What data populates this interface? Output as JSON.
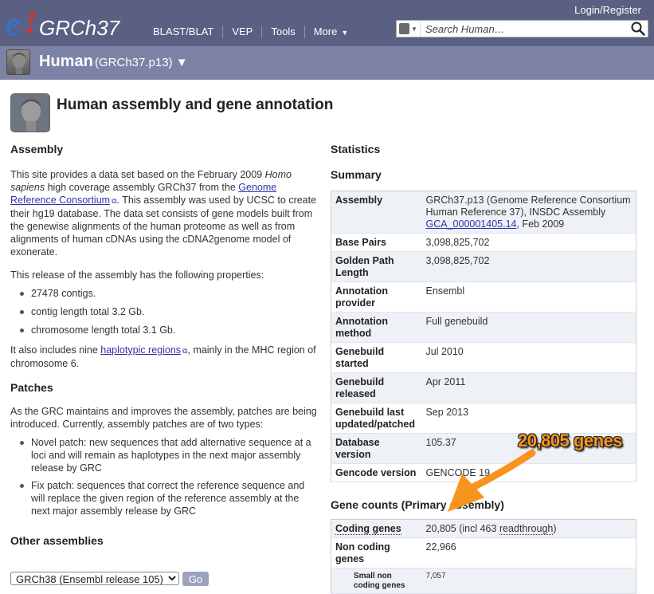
{
  "masthead": {
    "logo": {
      "e": "e",
      "bang": "!",
      "text": "GRCh37"
    },
    "nav": [
      {
        "label": "BLAST/BLAT"
      },
      {
        "label": "VEP"
      },
      {
        "label": "Tools"
      },
      {
        "label": "More",
        "caret": "▼"
      }
    ],
    "login": "Login/Register",
    "search": {
      "placeholder": "Search Human…",
      "icon": "search-icon"
    }
  },
  "species": {
    "name": "Human",
    "assembly": "(GRCh37.p13) ▼"
  },
  "page": {
    "title": "Human assembly and gene annotation"
  },
  "assembly": {
    "heading": "Assembly",
    "p1_a": "This site provides a data set based on the February 2009 ",
    "p1_em": "Homo sapiens",
    "p1_b": " high coverage assembly GRCh37 from the ",
    "p1_link": "Genome Reference Consortium",
    "p1_c": ". This assembly was used by UCSC to create their hg19 database. The data set consists of gene models built from the genewise alignments of the human proteome as well as from alignments of human cDNAs using the cDNA2genome model of exonerate.",
    "p2": "This release of the assembly has the following properties:",
    "properties": [
      "27478 contigs.",
      "contig length total 3.2 Gb.",
      "chromosome length total 3.1 Gb."
    ],
    "p3_a": "It also includes nine ",
    "p3_link": "haplotypic regions",
    "p3_b": ", mainly in the MHC region of chromosome 6."
  },
  "patches": {
    "heading": "Patches",
    "intro": "As the GRC maintains and improves the assembly, patches are being introduced. Currently, assembly patches are of two types:",
    "items": [
      "Novel patch: new sequences that add alternative sequence at a loci and will remain as haplotypes in the next major assembly release by GRC",
      "Fix patch: sequences that correct the reference sequence and will replace the given region of the reference assembly at the next major assembly release by GRC"
    ]
  },
  "other": {
    "heading": "Other assemblies",
    "selected": "GRCh38 (Ensembl release 105)",
    "go": "Go"
  },
  "statistics": {
    "heading": "Statistics",
    "summary_heading": "Summary",
    "summary": [
      {
        "label": "Assembly",
        "value_a": "GRCh37.p13 (Genome Reference Consortium Human Reference 37), INSDC Assembly ",
        "value_link": "GCA_000001405.14",
        "value_b": ", Feb 2009"
      },
      {
        "label": "Base Pairs",
        "value": "3,098,825,702"
      },
      {
        "label": "Golden Path Length",
        "value": "3,098,825,702"
      },
      {
        "label": "Annotation provider",
        "value": "Ensembl"
      },
      {
        "label": "Annotation method",
        "value": "Full genebuild"
      },
      {
        "label": "Genebuild started",
        "value": "Jul 2010"
      },
      {
        "label": "Genebuild released",
        "value": "Apr 2011"
      },
      {
        "label": "Genebuild last updated/patched",
        "value": "Sep 2013"
      },
      {
        "label": "Database version",
        "value": "105.37"
      },
      {
        "label": "Gencode version",
        "value": "GENCODE 19"
      }
    ],
    "gene_counts_heading": "Gene counts (Primary assembly)",
    "gene_counts": [
      {
        "label": "Coding genes",
        "value_a": "20,805 (incl 463 ",
        "value_dotted": "readthrough",
        "value_b": ")"
      },
      {
        "label": "Non coding genes",
        "value": "22,966"
      },
      {
        "label": "Small non coding genes",
        "value": "7,057"
      }
    ]
  },
  "annotation": {
    "text": "20,805 genes",
    "color": "#f7941d"
  }
}
